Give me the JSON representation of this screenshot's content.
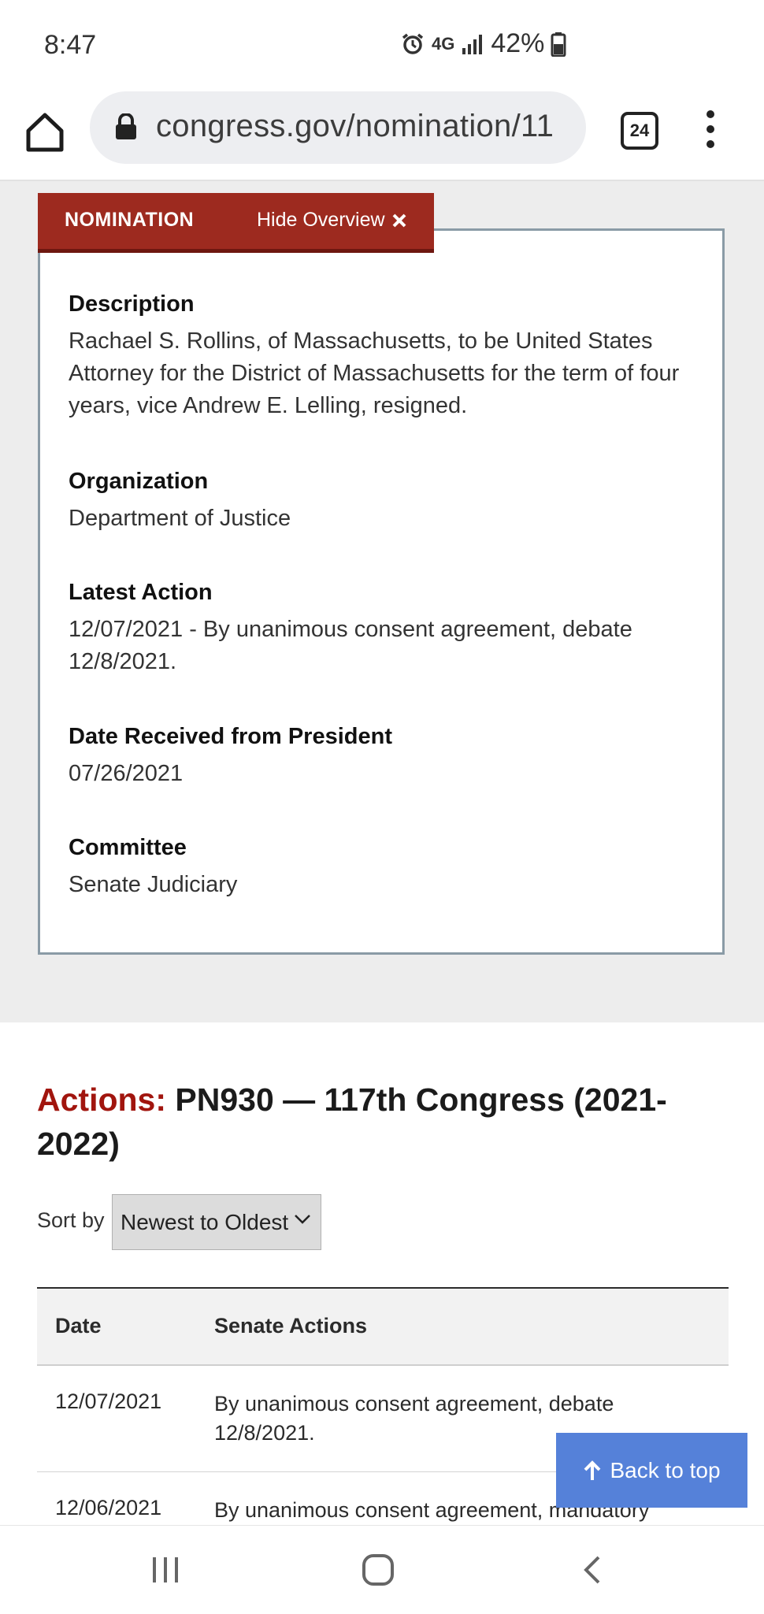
{
  "status_bar": {
    "time": "8:47",
    "network": "4G",
    "battery": "42%"
  },
  "browser": {
    "url": "congress.gov/nomination/11",
    "tab_count": "24"
  },
  "overview": {
    "header_title": "NOMINATION",
    "hide_label": "Hide Overview",
    "fields": [
      {
        "label": "Description",
        "value": "Rachael S. Rollins, of Massachusetts, to be United States Attorney for the District of Massachusetts for the term of four years, vice Andrew E. Lelling, resigned."
      },
      {
        "label": "Organization",
        "value": "Department of Justice"
      },
      {
        "label": "Latest Action",
        "value": "12/07/2021 - By unanimous consent agreement, debate 12/8/2021."
      },
      {
        "label": "Date Received from President",
        "value": "07/26/2021"
      },
      {
        "label": "Committee",
        "value": "Senate Judiciary"
      }
    ]
  },
  "actions": {
    "heading_accent": "Actions:",
    "heading_rest": "PN930 — 117th Congress (2021-2022)",
    "sort_label": "Sort by",
    "sort_value": "Newest to Oldest",
    "columns": [
      "Date",
      "Senate Actions"
    ],
    "rows": [
      {
        "date": "12/07/2021",
        "action": "By unanimous consent agreement, debate 12/8/2021."
      },
      {
        "date": "12/06/2021",
        "action": "By unanimous consent agreement, mandatory"
      }
    ]
  },
  "back_to_top": "Back to top",
  "colors": {
    "header_red": "#9d2a1f",
    "accent_red": "#a1150e",
    "back_to_top_blue": "#5581d9"
  }
}
